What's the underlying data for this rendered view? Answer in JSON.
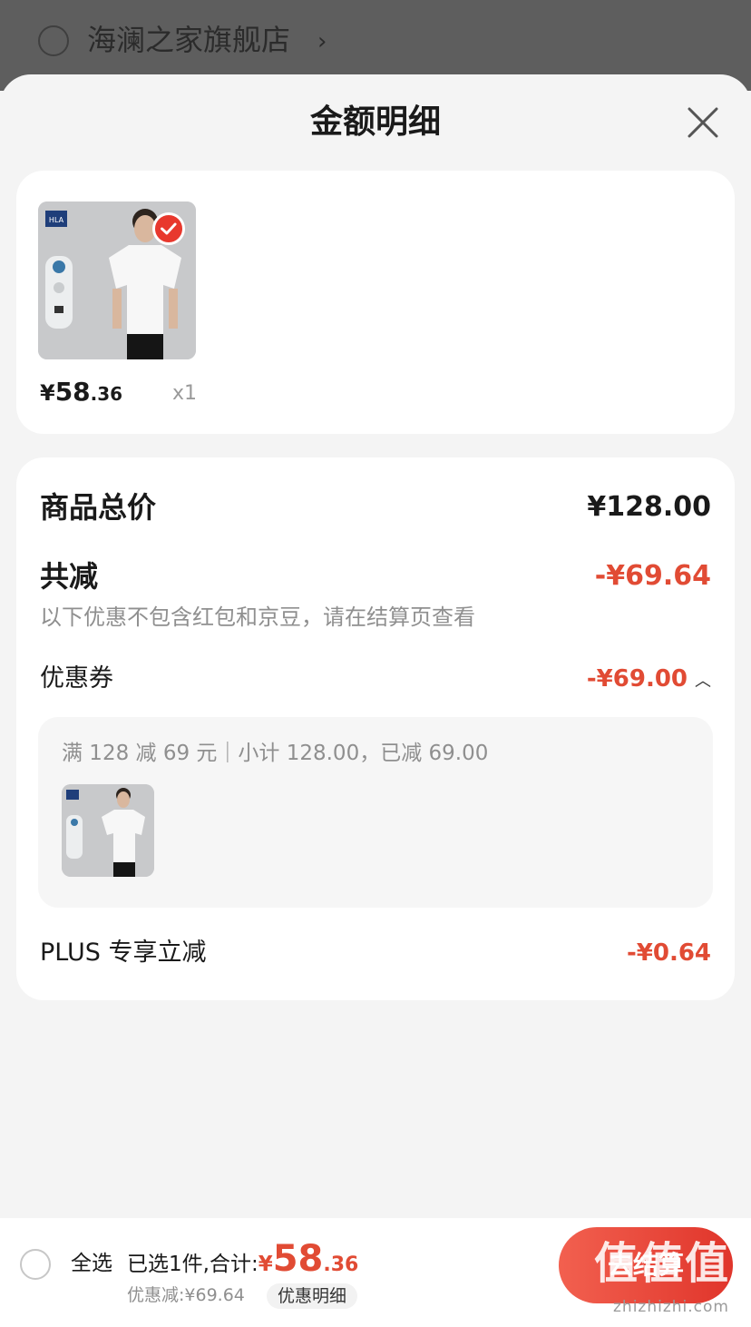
{
  "store": {
    "name": "海澜之家旗舰店"
  },
  "sheet": {
    "title": "金额明细"
  },
  "product": {
    "brand_tag": "HLA",
    "price_symbol": "¥",
    "price_int": "58",
    "price_dec": ".36",
    "qty": "x1"
  },
  "summary": {
    "total_label": "商品总价",
    "total_value": "¥128.00",
    "discount_label": "共减",
    "discount_value": "-¥69.64",
    "hint": "以下优惠不包含红包和京豆，请在结算页查看",
    "coupon_label": "优惠券",
    "coupon_value": "-¥69.00",
    "coupon_detail": "满 128 减 69 元｜小计 128.00，已减 69.00",
    "plus_label": "PLUS 专享立减",
    "plus_value": "-¥0.64"
  },
  "footer": {
    "select_all": "全选",
    "selected_text": "已选1件,合计:",
    "total_symbol": "¥",
    "total_int": "58",
    "total_dec": ".36",
    "discount_text": "优惠减:¥69.64",
    "detail_label": "优惠明细",
    "checkout_label": "去结算"
  },
  "watermark": {
    "text": "值值值",
    "url": "zhizhizhi.com"
  },
  "colors": {
    "accent": "#e14b34",
    "overlay": "#5e5e5e",
    "background": "#f4f4f4"
  }
}
